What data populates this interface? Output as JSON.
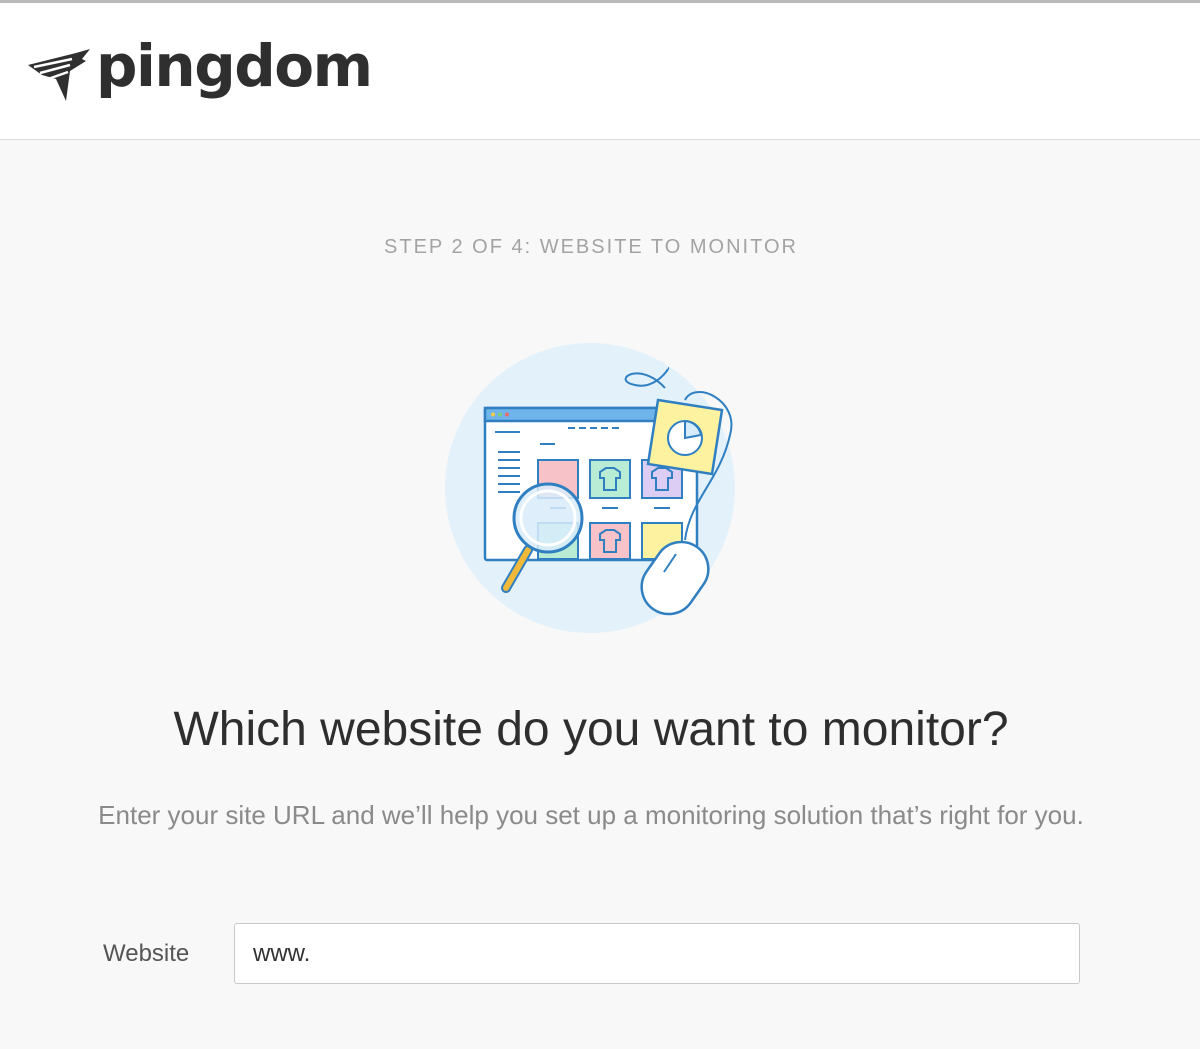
{
  "header": {
    "brand_name": "pingdom",
    "logo_icon": "pingdom-bird-icon"
  },
  "step": {
    "label": "STEP 2 OF 4: WEBSITE TO MONITOR"
  },
  "illustration": {
    "icon": "website-monitoring-illustration",
    "colors": {
      "circle_bg": "#e3f1fb",
      "stroke": "#2f7fc1",
      "browser_bar": "#6fb4ea",
      "tag_yellow": "#fdf2a0",
      "magnifier_handle": "#f0b93a"
    }
  },
  "main": {
    "title": "Which website do you want to monitor?",
    "subtitle": "Enter your site URL and we’ll help you set up a monitoring solution that’s right for you."
  },
  "form": {
    "website_label": "Website",
    "website_value": "www."
  }
}
